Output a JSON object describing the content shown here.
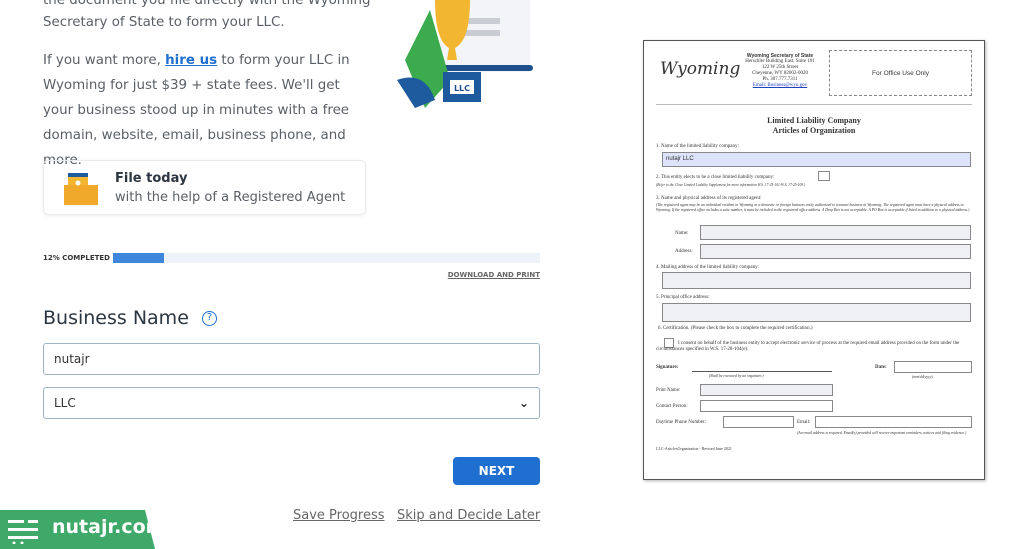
{
  "intro": {
    "line_partial": "the document you file directly with the Wyoming",
    "line2": "Secretary of State to form your LLC.",
    "p2_before": "If you want more, ",
    "p2_link": "hire us",
    "p2_after": " to form your LLC in Wyoming for just $39 + state fees. We'll get your business stood up in minutes with a free domain, website, email, business phone, and more."
  },
  "illustration": {
    "badge": "LLC"
  },
  "card": {
    "title": "File today",
    "subtitle": "with the help of a Registered Agent"
  },
  "progress": {
    "label": "12% COMPLETED",
    "percent": 12
  },
  "download_label": "DOWNLOAD AND PRINT",
  "form": {
    "heading": "Business Name",
    "name_value": "nutajr",
    "entity_type": "LLC",
    "next_label": "NEXT",
    "save_label": "Save Progress",
    "skip_label": "Skip and Decide Later"
  },
  "watermark": {
    "text": "nutajr.com"
  },
  "colors": {
    "accent": "#1f6fd1",
    "brand_green": "#3fa96a"
  },
  "document": {
    "logo": "Wyoming",
    "office": "Wyoming Secretary of State",
    "address1": "Herschler Building East, Suite 101",
    "address2": "122 W 25th Street",
    "address3": "Cheyenne, WY 82002-0020",
    "phone": "Ph. 307.777.7311",
    "email": "Email: Business@wyo.gov",
    "office_use": "For Office Use Only",
    "title1": "Limited Liability Company",
    "title2": "Articles of Organization",
    "q1": "1. Name of the limited liability company:",
    "q1_value": "nutajr LLC",
    "q2": "2. This entity elects to be a close limited liability company:",
    "q2_note": "(Refer to the Close Limited Liability Supplement for more information W.S. 17-25-101-W.S. 17-25-109.)",
    "q3": "3. Name and physical address of its registered agent:",
    "q3_note": "(The registered agent may be an individual resident in Wyoming or a domestic or foreign business entity authorized to transact business in Wyoming. The registered agent must have a physical address in Wyoming. If the registered office includes a suite number, it must be included in the registered office address. A Drop Box is not acceptable. A PO Box is acceptable if listed in addition to a physical address.)",
    "name_label": "Name:",
    "address_label": "Address:",
    "q4": "4. Mailing address of the limited liability company:",
    "q5": "5. Principal office address:",
    "q6": "6. Certification. (Please check the box to complete the required certification.)",
    "consent": "I consent on behalf of the business entity to accept electronic service of process at the required email address provided on the form under the circumstances specified in W.S. 17-28-104(e).",
    "signature": "Signature:",
    "signature_note": "(Shall be executed by an organizer.)",
    "date": "Date:",
    "date_note": "(mm/dd/yyyy)",
    "print_name": "Print Name:",
    "contact": "Contact Person:",
    "phone_label": "Daytime Phone Number:",
    "email_label": "Email:",
    "email_note": "(An email address is required. Email(s) provided will receive important reminders, notices and filing evidence.)",
    "footer": "LLC-ArticlesOrganization - Revised June 2021"
  }
}
